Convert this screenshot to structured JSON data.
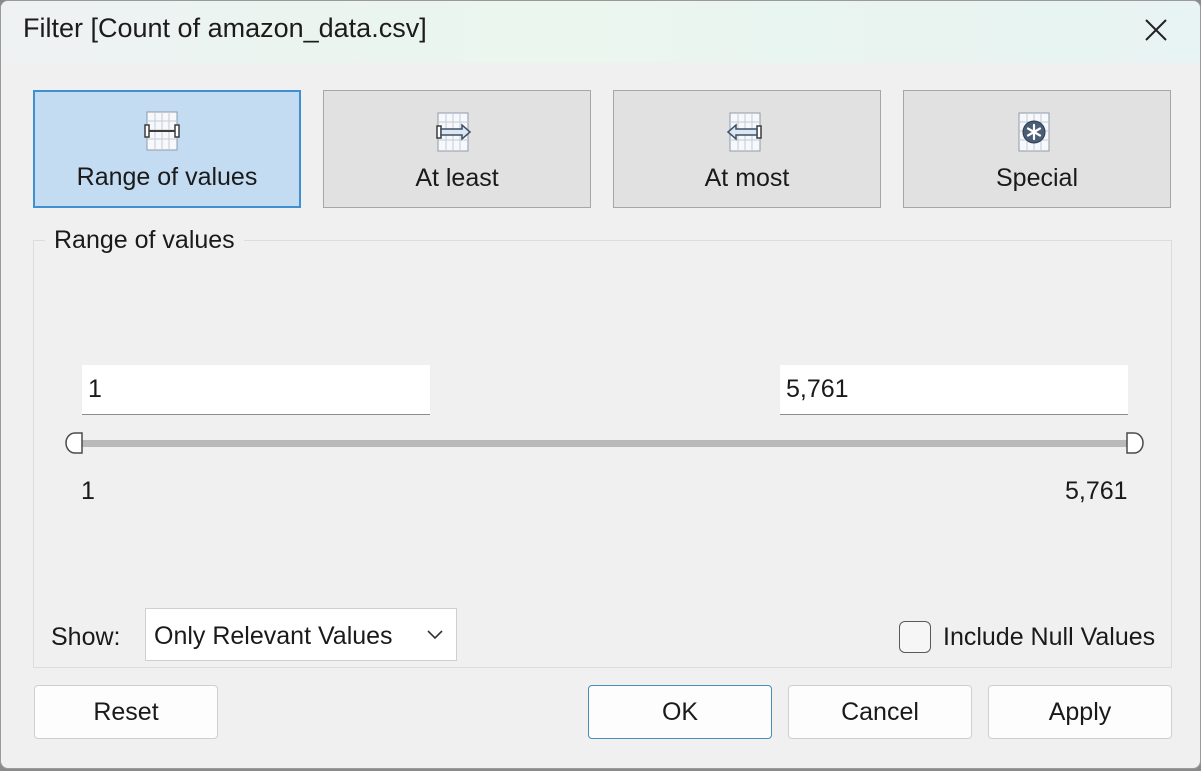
{
  "window": {
    "title": "Filter [Count of amazon_data.csv]"
  },
  "tabs": [
    {
      "label": "Range of values",
      "icon": "range-icon",
      "selected": true
    },
    {
      "label": "At least",
      "icon": "at-least-icon",
      "selected": false
    },
    {
      "label": "At most",
      "icon": "at-most-icon",
      "selected": false
    },
    {
      "label": "Special",
      "icon": "special-icon",
      "selected": false
    }
  ],
  "range": {
    "group_label": "Range of values",
    "min_value": "1",
    "max_value": "5,761",
    "slider_min_label": "1",
    "slider_max_label": "5,761"
  },
  "show": {
    "label": "Show:",
    "selected": "Only Relevant Values"
  },
  "include_null": {
    "label": "Include Null Values",
    "checked": false
  },
  "buttons": {
    "reset": "Reset",
    "ok": "OK",
    "cancel": "Cancel",
    "apply": "Apply"
  },
  "colors": {
    "selected_tab_bg": "#c3dcf2",
    "selected_tab_border": "#3f8fd1",
    "primary_border": "#4a8bb8"
  }
}
